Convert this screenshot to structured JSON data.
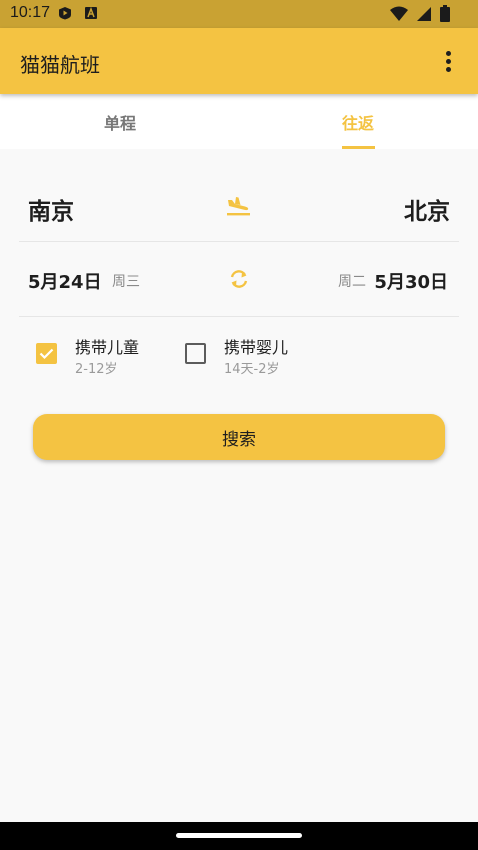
{
  "status_bar": {
    "time": "10:17",
    "left_icons": [
      "media-play-icon",
      "a-notification-icon"
    ],
    "right_icons": [
      "wifi-icon",
      "signal-icon",
      "battery-icon"
    ]
  },
  "app_bar": {
    "title": "猫猫航班",
    "menu_icon": "more-vert-icon"
  },
  "tabs": [
    {
      "label": "单程",
      "selected": false
    },
    {
      "label": "往返",
      "selected": true
    }
  ],
  "route": {
    "from_city": "南京",
    "to_city": "北京",
    "icon": "flight-land-icon"
  },
  "dates": {
    "depart_date": "5月24日",
    "depart_weekday": "周三",
    "return_date": "5月30日",
    "return_weekday": "周二",
    "icon": "swap-icon"
  },
  "options": [
    {
      "label": "携带儿童",
      "sublabel": "2-12岁",
      "checked": true
    },
    {
      "label": "携带婴儿",
      "sublabel": "14天-2岁",
      "checked": false
    }
  ],
  "search_button": {
    "label": "搜索"
  },
  "colors": {
    "accent": "#f4c342",
    "status_bar": "#c9a233",
    "background": "#f9f9f9",
    "text_primary": "#1e1e1e",
    "text_secondary": "#8a8a8a"
  }
}
